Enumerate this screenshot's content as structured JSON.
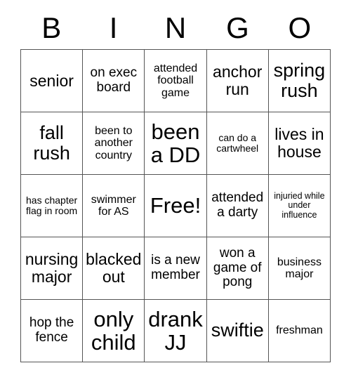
{
  "card": {
    "header_letters": [
      "B",
      "I",
      "N",
      "G",
      "O"
    ],
    "rows": [
      [
        {
          "text": "senior",
          "size": "fs-lg"
        },
        {
          "text": "on exec board",
          "size": "fs-md"
        },
        {
          "text": "attended football game",
          "size": "fs-sm"
        },
        {
          "text": "anchor run",
          "size": "fs-lg"
        },
        {
          "text": "spring rush",
          "size": "fs-xl"
        }
      ],
      [
        {
          "text": "fall rush",
          "size": "fs-xl"
        },
        {
          "text": "been to another country",
          "size": "fs-sm"
        },
        {
          "text": "been a DD",
          "size": "fs-xxl"
        },
        {
          "text": "can do a cartwheel",
          "size": "fs-xs"
        },
        {
          "text": "lives in house",
          "size": "fs-lg"
        }
      ],
      [
        {
          "text": "has chapter flag in room",
          "size": "fs-xs"
        },
        {
          "text": "swimmer for AS",
          "size": "fs-sm"
        },
        {
          "text": "Free!",
          "size": "fs-xxl"
        },
        {
          "text": "attended a darty",
          "size": "fs-md"
        },
        {
          "text": "injuried while under influence",
          "size": "fs-xxs"
        }
      ],
      [
        {
          "text": "nursing major",
          "size": "fs-lg"
        },
        {
          "text": "blacked out",
          "size": "fs-lg"
        },
        {
          "text": "is a new member",
          "size": "fs-md"
        },
        {
          "text": "won a game of pong",
          "size": "fs-md"
        },
        {
          "text": "business major",
          "size": "fs-sm"
        }
      ],
      [
        {
          "text": "hop the fence",
          "size": "fs-md"
        },
        {
          "text": "only child",
          "size": "fs-xxl"
        },
        {
          "text": "drank JJ",
          "size": "fs-xxl"
        },
        {
          "text": "swiftie",
          "size": "fs-xl"
        },
        {
          "text": "freshman",
          "size": "fs-sm"
        }
      ]
    ],
    "colors": {
      "background": "#ffffff",
      "text": "#000000",
      "border": "#555555"
    }
  }
}
